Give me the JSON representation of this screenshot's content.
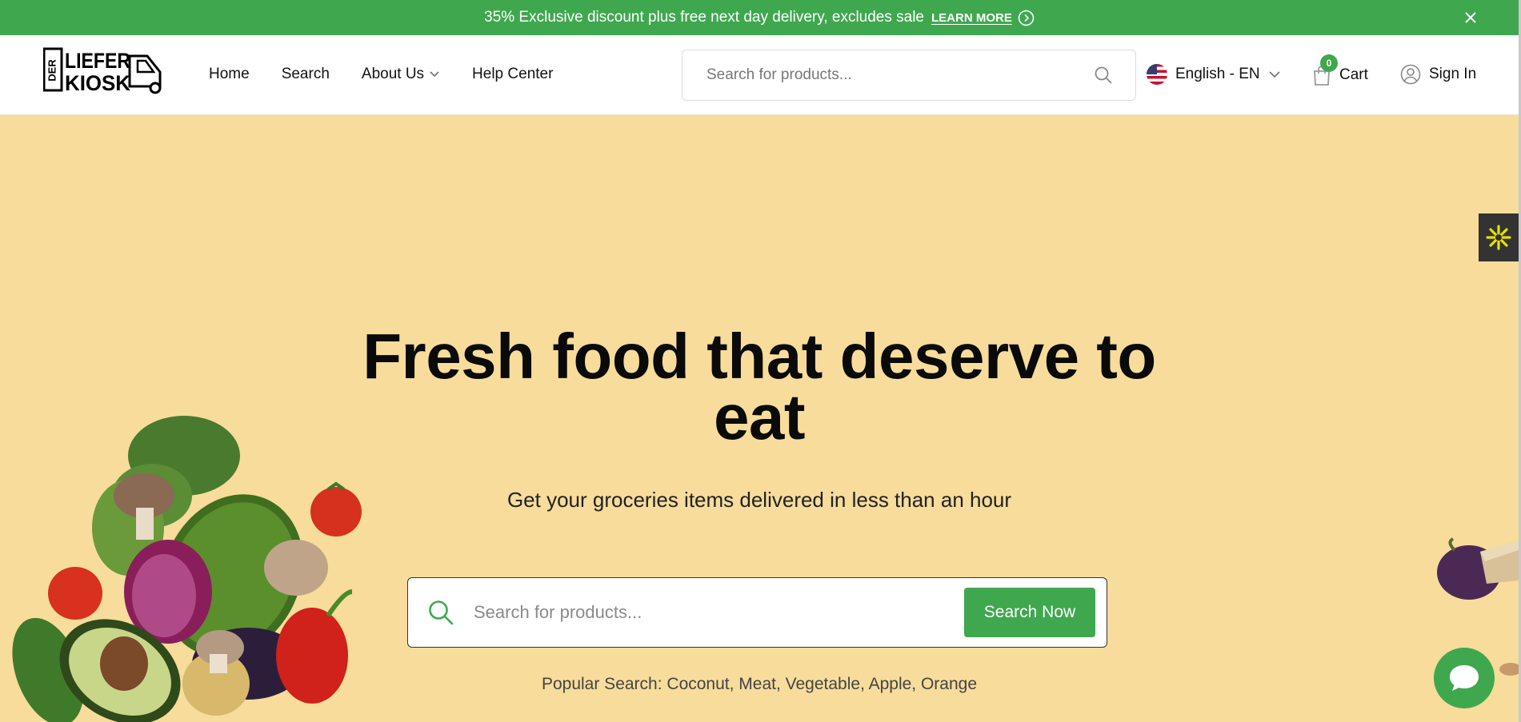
{
  "announcement": {
    "text": "35% Exclusive discount plus free next day delivery, excludes sale",
    "link_label": "LEARN MORE"
  },
  "header": {
    "logo_alt": "DER LIEFER KIOSK",
    "nav": [
      {
        "label": "Home"
      },
      {
        "label": "Search"
      },
      {
        "label": "About Us",
        "has_dropdown": true
      },
      {
        "label": "Help Center"
      }
    ],
    "search_placeholder": "Search for products...",
    "language": "English - EN",
    "cart_label": "Cart",
    "cart_count": "0",
    "signin_label": "Sign In"
  },
  "hero": {
    "title_line1": "Fresh food that deserve to",
    "title_line2": "eat",
    "subtitle": "Get your groceries items delivered in less than an hour",
    "search_placeholder": "Search for products...",
    "search_button": "Search Now",
    "popular_prefix": "Popular Search:",
    "popular_terms": "Coconut, Meat, Vegetable, Apple, Orange"
  },
  "colors": {
    "brand_green": "#3fa84f",
    "hero_background": "#f7dc9b"
  }
}
